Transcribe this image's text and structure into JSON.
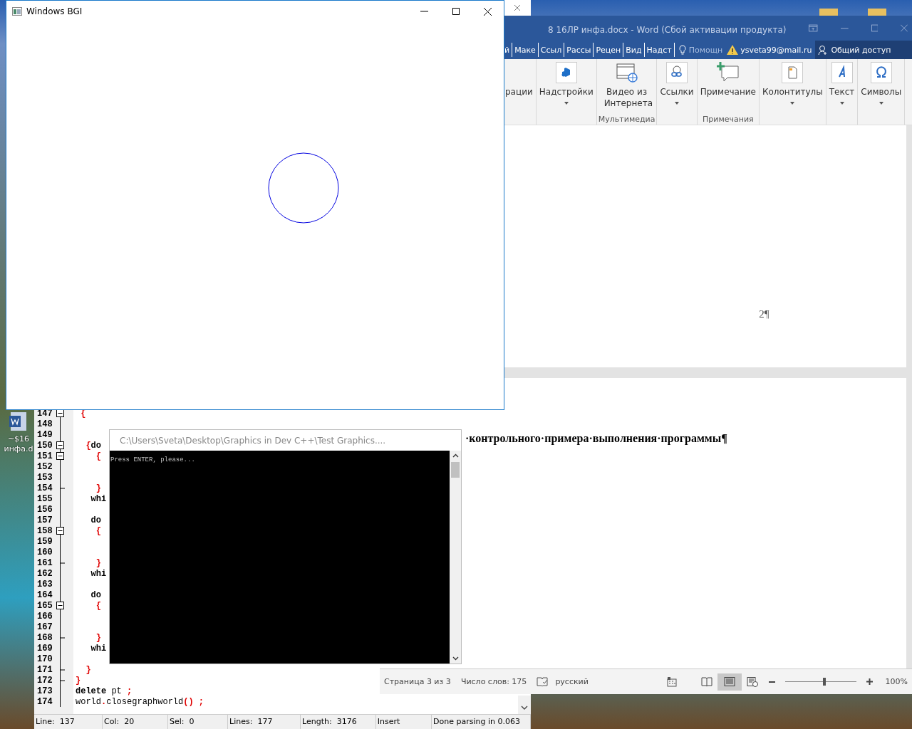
{
  "desktop": {
    "icon_label": [
      "~$16",
      "инфа.d"
    ]
  },
  "bgi_window": {
    "title": "Windows BGI"
  },
  "word": {
    "title": "8 16ЛР инфа.docx - Word (Сбой активации продукта)",
    "tabs": [
      {
        "label": "й",
        "selected": false
      },
      {
        "label": "Маке",
        "selected": false
      },
      {
        "label": "Ссыл",
        "selected": false
      },
      {
        "label": "Рассы",
        "selected": false
      },
      {
        "label": "Рецен",
        "selected": false
      },
      {
        "label": "Вид",
        "selected": false
      },
      {
        "label": "Надст",
        "selected": false
      }
    ],
    "tell_me": "Помощн",
    "account": "ysveta99@mail.ru",
    "share": "Общий доступ",
    "ribbon": [
      {
        "items": [
          {
            "kind": "plain",
            "label": "рации",
            "dropdown": false
          }
        ]
      },
      {
        "items": [
          {
            "kind": "addin",
            "label": "Надстройки",
            "dropdown": true
          }
        ]
      },
      {
        "group": "Мультимедиа",
        "items": [
          {
            "kind": "video",
            "label": "Видео из Интернета",
            "dropdown": false
          }
        ]
      },
      {
        "items": [
          {
            "kind": "link",
            "label": "Ссылки",
            "dropdown": true
          }
        ]
      },
      {
        "group": "Примечания",
        "items": [
          {
            "kind": "comment",
            "label": "Примечание",
            "dropdown": false
          }
        ]
      },
      {
        "items": [
          {
            "kind": "header",
            "label": "Колонтитулы",
            "dropdown": true
          }
        ]
      },
      {
        "items": [
          {
            "kind": "text",
            "label": "Текст",
            "dropdown": true
          }
        ]
      },
      {
        "items": [
          {
            "kind": "symbol",
            "label": "Символы",
            "dropdown": true
          }
        ]
      }
    ],
    "page_number": "2¶",
    "heading": "·контрольного·примера·выполнения·программы¶",
    "status": {
      "page": "Страница 3 из 3",
      "words": "Число слов: 175",
      "language": "русский",
      "views": [
        {
          "kind": "read",
          "selected": false
        },
        {
          "kind": "print",
          "selected": true
        },
        {
          "kind": "web",
          "selected": false
        }
      ],
      "zoom": {
        "level": 0.55,
        "reading": "100%"
      }
    }
  },
  "editor": {
    "lines": [
      {
        "number": "147",
        "kind": "fold-start",
        "tokens": [
          {
            "kind": "sym",
            "text": " {"
          }
        ]
      },
      {
        "number": "148",
        "kind": "plain"
      },
      {
        "number": "149",
        "kind": "plain"
      },
      {
        "number": "150",
        "kind": "fold-start",
        "tokens": [
          {
            "kind": "sym",
            "text": "  {"
          },
          {
            "kind": "kw",
            "text": "do"
          }
        ]
      },
      {
        "number": "151",
        "kind": "fold-start",
        "tokens": [
          {
            "kind": "sym",
            "text": "    {"
          }
        ]
      },
      {
        "number": "152",
        "kind": "plain"
      },
      {
        "number": "153",
        "kind": "plain"
      },
      {
        "number": "154",
        "kind": "fold-end",
        "tokens": [
          {
            "kind": "sym",
            "text": "    }"
          }
        ]
      },
      {
        "number": "155",
        "kind": "plain",
        "tokens": [
          {
            "kind": "kw",
            "text": "   whi"
          }
        ]
      },
      {
        "number": "156",
        "kind": "plain"
      },
      {
        "number": "157",
        "kind": "plain",
        "tokens": [
          {
            "kind": "kw",
            "text": "   do"
          }
        ]
      },
      {
        "number": "158",
        "kind": "fold-start",
        "tokens": [
          {
            "kind": "sym",
            "text": "    {"
          }
        ]
      },
      {
        "number": "159",
        "kind": "plain"
      },
      {
        "number": "160",
        "kind": "plain"
      },
      {
        "number": "161",
        "kind": "fold-end",
        "tokens": [
          {
            "kind": "sym",
            "text": "    }"
          }
        ]
      },
      {
        "number": "162",
        "kind": "plain",
        "tokens": [
          {
            "kind": "kw",
            "text": "   whi"
          }
        ]
      },
      {
        "number": "163",
        "kind": "plain"
      },
      {
        "number": "164",
        "kind": "plain",
        "tokens": [
          {
            "kind": "kw",
            "text": "   do"
          }
        ]
      },
      {
        "number": "165",
        "kind": "fold-start",
        "tokens": [
          {
            "kind": "sym",
            "text": "    {"
          }
        ]
      },
      {
        "number": "166",
        "kind": "plain"
      },
      {
        "number": "167",
        "kind": "plain"
      },
      {
        "number": "168",
        "kind": "fold-end",
        "tokens": [
          {
            "kind": "sym",
            "text": "    }"
          }
        ]
      },
      {
        "number": "169",
        "kind": "plain",
        "tokens": [
          {
            "kind": "kw",
            "text": "   whi"
          }
        ]
      },
      {
        "number": "170",
        "kind": "plain"
      },
      {
        "number": "171",
        "kind": "fold-end",
        "tokens": [
          {
            "kind": "sym",
            "text": "  }"
          }
        ]
      },
      {
        "number": "172",
        "kind": "fold-end",
        "tokens": [
          {
            "kind": "sym",
            "text": "}"
          }
        ]
      },
      {
        "number": "173",
        "kind": "plain",
        "tokens": [
          {
            "kind": "kw",
            "text": "delete"
          },
          {
            "kind": "txt",
            "text": " pt "
          },
          {
            "kind": "sym",
            "text": ";"
          }
        ]
      },
      {
        "number": "174",
        "kind": "plain",
        "tokens": [
          {
            "kind": "txt",
            "text": "world"
          },
          {
            "kind": "sym",
            "text": "."
          },
          {
            "kind": "txt",
            "text": "closegraphworld"
          },
          {
            "kind": "sym",
            "text": "() ;"
          }
        ]
      }
    ],
    "status": [
      {
        "label": "Line:",
        "value": "137"
      },
      {
        "label": "Col:",
        "value": "20"
      },
      {
        "label": "Sel:",
        "value": "0"
      },
      {
        "label": "Lines:",
        "value": "177"
      },
      {
        "label": "Length:",
        "value": "3176"
      },
      {
        "label": "Insert"
      },
      {
        "label": "Done parsing in 0.063"
      }
    ]
  },
  "console": {
    "title": "C:\\Users\\Sveta\\Desktop\\Graphics in Dev C++\\Test Graphics....",
    "output": "Press ENTER, please..."
  }
}
